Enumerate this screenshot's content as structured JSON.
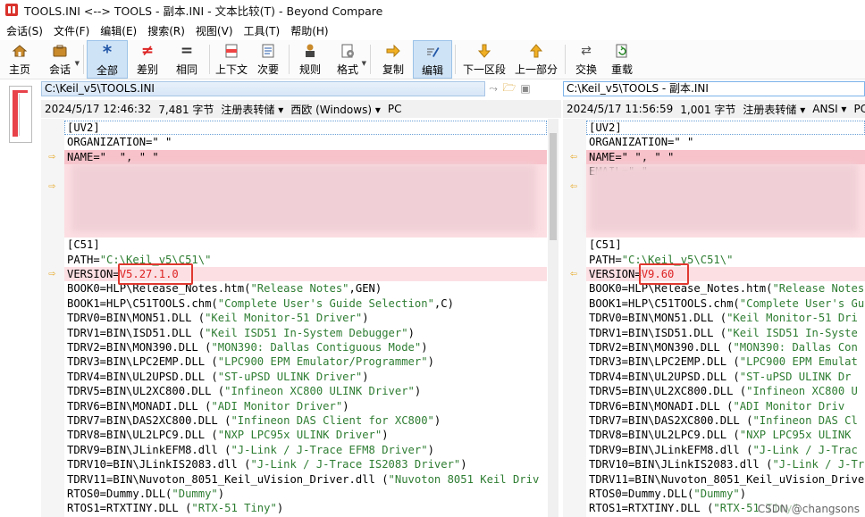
{
  "window": {
    "title": "TOOLS.INI <--> TOOLS - 副本.INI - 文本比较(T) - Beyond Compare"
  },
  "menu": [
    "会话(S)",
    "文件(F)",
    "编辑(E)",
    "搜索(R)",
    "视图(V)",
    "工具(T)",
    "帮助(H)"
  ],
  "toolbar": {
    "home": "主页",
    "session": "会话",
    "all": "全部",
    "diff": "差别",
    "same": "相同",
    "context": "上下文",
    "minor": "次要",
    "rules": "规则",
    "format": "格式",
    "copy": "复制",
    "edit": "编辑",
    "next": "下一区段",
    "prev": "上一部分",
    "swap": "交换",
    "reload": "重载"
  },
  "left": {
    "path": "C:\\Keil_v5\\TOOLS.INI",
    "info": {
      "datetime": "2024/5/17 12:46:32",
      "size": "7,481 字节",
      "encoding_label": "注册表转储 ▾",
      "charset": "西欧 (Windows) ▾",
      "eol": "PC"
    }
  },
  "right": {
    "path": "C:\\Keil_v5\\TOOLS - 副本.INI",
    "info": {
      "datetime": "2024/5/17 11:56:59",
      "size": "1,001 字节",
      "encoding_label": "注册表转储 ▾",
      "charset": "ANSI ▾",
      "eol": "PC"
    }
  },
  "lines_left": [
    [
      "[UV2]",
      ""
    ],
    [
      "ORGANIZATION=\" \"",
      ""
    ],
    [
      "NAME=\"  \", \" \"",
      ""
    ],
    [
      "",
      ""
    ],
    [
      "",
      ""
    ],
    [
      "",
      ""
    ],
    [
      "",
      ""
    ],
    [
      "",
      ""
    ],
    [
      "[C51]",
      ""
    ],
    [
      "PATH=",
      "\"C:\\Keil_v5\\C51\\\""
    ],
    [
      "VERSION=",
      "V5.27.1.0"
    ],
    [
      "BOOK0=HLP\\Release_Notes.htm(",
      "\"Release Notes\"",
      ",GEN)"
    ],
    [
      "BOOK1=HLP\\C51TOOLS.chm(",
      "\"Complete User's Guide Selection\"",
      ",C)"
    ],
    [
      "TDRV0=BIN\\MON51.DLL (",
      "\"Keil Monitor-51 Driver\"",
      ")"
    ],
    [
      "TDRV1=BIN\\ISD51.DLL (",
      "\"Keil ISD51 In-System Debugger\"",
      ")"
    ],
    [
      "TDRV2=BIN\\MON390.DLL (",
      "\"MON390: Dallas Contiguous Mode\"",
      ")"
    ],
    [
      "TDRV3=BIN\\LPC2EMP.DLL (",
      "\"LPC900 EPM Emulator/Programmer\"",
      ")"
    ],
    [
      "TDRV4=BIN\\UL2UPSD.DLL (",
      "\"ST-uPSD ULINK Driver\"",
      ")"
    ],
    [
      "TDRV5=BIN\\UL2XC800.DLL (",
      "\"Infineon XC800 ULINK Driver\"",
      ")"
    ],
    [
      "TDRV6=BIN\\MONADI.DLL (",
      "\"ADI Monitor Driver\"",
      ")"
    ],
    [
      "TDRV7=BIN\\DAS2XC800.DLL (",
      "\"Infineon DAS Client for XC800\"",
      ")"
    ],
    [
      "TDRV8=BIN\\UL2LPC9.DLL (",
      "\"NXP LPC95x ULINK Driver\"",
      ")"
    ],
    [
      "TDRV9=BIN\\JLinkEFM8.dll (",
      "\"J-Link / J-Trace EFM8 Driver\"",
      ")"
    ],
    [
      "TDRV10=BIN\\JLinkIS2083.dll (",
      "\"J-Link / J-Trace IS2083 Driver\"",
      ")"
    ],
    [
      "TDRV11=BIN\\Nuvoton_8051_Keil_uVision_Driver.dll (",
      "\"Nuvoton 8051 Keil Driv",
      ""
    ],
    [
      "RTOS0=Dummy.DLL(",
      "\"Dummy\"",
      ")"
    ],
    [
      "RTOS1=RTXTINY.DLL (",
      "\"RTX-51 Tiny\"",
      ")"
    ]
  ],
  "lines_right": [
    [
      "[UV2]",
      ""
    ],
    [
      "ORGANIZATION=\" \"",
      ""
    ],
    [
      "NAME=\" \", \" \"",
      ""
    ],
    [
      "EMAIL=\" \"",
      ""
    ],
    [
      "",
      ""
    ],
    [
      "",
      ""
    ],
    [
      "",
      ""
    ],
    [
      "",
      ""
    ],
    [
      "[C51]",
      ""
    ],
    [
      "PATH=",
      "\"C:\\Keil_v5\\C51\\\""
    ],
    [
      "VERSION=",
      "V9.60"
    ],
    [
      "BOOK0=HLP\\Release_Notes.htm(",
      "\"Release Notes\"",
      ""
    ],
    [
      "BOOK1=HLP\\C51TOOLS.chm(",
      "\"Complete User's Gu",
      ""
    ],
    [
      "TDRV0=BIN\\MON51.DLL (",
      "\"Keil Monitor-51 Dri",
      ""
    ],
    [
      "TDRV1=BIN\\ISD51.DLL (",
      "\"Keil ISD51 In-Syste",
      ""
    ],
    [
      "TDRV2=BIN\\MON390.DLL (",
      "\"MON390: Dallas Con",
      ""
    ],
    [
      "TDRV3=BIN\\LPC2EMP.DLL (",
      "\"LPC900 EPM Emulat",
      ""
    ],
    [
      "TDRV4=BIN\\UL2UPSD.DLL (",
      "\"ST-uPSD ULINK Dr",
      ""
    ],
    [
      "TDRV5=BIN\\UL2XC800.DLL (",
      "\"Infineon XC800 U",
      ""
    ],
    [
      "TDRV6=BIN\\MONADI.DLL (",
      "\"ADI Monitor Driv",
      ""
    ],
    [
      "TDRV7=BIN\\DAS2XC800.DLL (",
      "\"Infineon DAS Cl",
      ""
    ],
    [
      "TDRV8=BIN\\UL2LPC9.DLL (",
      "\"NXP LPC95x ULINK",
      ""
    ],
    [
      "TDRV9=BIN\\JLinkEFM8.dll (",
      "\"J-Link / J-Trac",
      ""
    ],
    [
      "TDRV10=BIN\\JLinkIS2083.dll (",
      "\"J-Link / J-Tr",
      ""
    ],
    [
      "TDRV11=BIN\\Nuvoton_8051_Keil_uVision_Driver.dll",
      "",
      ""
    ],
    [
      "RTOS0=Dummy.DLL(",
      "\"Dummy\"",
      ")"
    ],
    [
      "RTOS1=RTXTINY.DLL (",
      "\"RTX-51 Tiny\"",
      ""
    ]
  ],
  "watermark": "CSDN @changsons"
}
